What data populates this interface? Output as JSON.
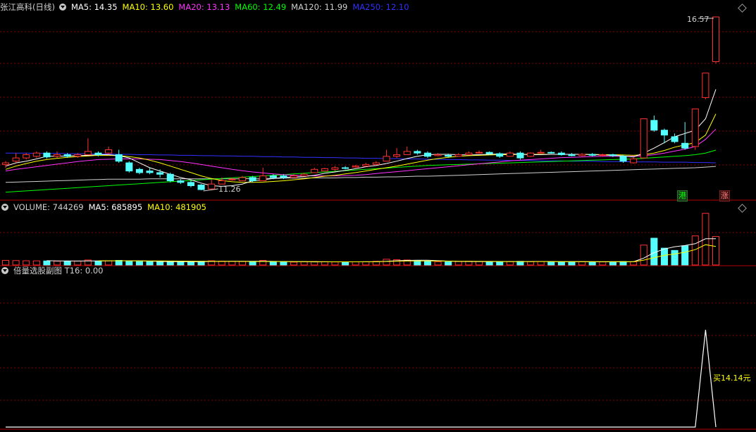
{
  "stock": {
    "name": "张江高科",
    "period": "(日线)"
  },
  "main_legend": [
    {
      "label": "MA5: 14.35",
      "color": "#ffffff"
    },
    {
      "label": "MA10: 13.60",
      "color": "#ffff00"
    },
    {
      "label": "MA20: 13.13",
      "color": "#ff33ff"
    },
    {
      "label": "MA60: 12.49",
      "color": "#00ff00"
    },
    {
      "label": "MA120: 11.99",
      "color": "#d0d0d0"
    },
    {
      "label": "MA250: 12.10",
      "color": "#3030ff"
    }
  ],
  "volume_legend": [
    {
      "label": "VOLUME: 744269",
      "color": "#d0d0d0"
    },
    {
      "label": "MA5: 685895",
      "color": "#ffffff"
    },
    {
      "label": "MA10: 481905",
      "color": "#ffff00"
    }
  ],
  "indicator_legend": {
    "label": "倍量选股副图  T16: 0.00",
    "color": "#d0d0d0"
  },
  "annotations": {
    "high": "16.57",
    "low": "11.26",
    "buy": "买14.14元"
  },
  "badges": {
    "hk": "港",
    "up": "涨"
  },
  "colors": {
    "up": "#ff3232",
    "down": "#54ffff",
    "grid": "#8a0000",
    "axis": "#b00000"
  },
  "chart_data": [
    {
      "type": "candlestick",
      "title": "张江高科 (日线)",
      "ohlc": [
        [
          12.05,
          12.1,
          11.95,
          12.15
        ],
        [
          12.15,
          12.25,
          12.1,
          12.4
        ],
        [
          12.25,
          12.35,
          12.2,
          12.4
        ],
        [
          12.3,
          12.4,
          12.25,
          12.45
        ],
        [
          12.4,
          12.28,
          12.23,
          12.45
        ],
        [
          12.3,
          12.35,
          12.25,
          12.45
        ],
        [
          12.35,
          12.3,
          12.25,
          12.4
        ],
        [
          12.3,
          12.35,
          12.25,
          12.4
        ],
        [
          12.35,
          12.45,
          12.35,
          12.85
        ],
        [
          12.4,
          12.35,
          12.3,
          12.45
        ],
        [
          12.4,
          12.5,
          12.35,
          12.6
        ],
        [
          12.35,
          12.15,
          12.1,
          12.5
        ],
        [
          12.1,
          11.85,
          11.8,
          12.15
        ],
        [
          11.9,
          11.8,
          11.75,
          11.95
        ],
        [
          11.85,
          11.8,
          11.75,
          11.95
        ],
        [
          11.8,
          11.75,
          11.65,
          11.9
        ],
        [
          11.75,
          11.55,
          11.5,
          11.8
        ],
        [
          11.55,
          11.5,
          11.45,
          11.6
        ],
        [
          11.5,
          11.4,
          11.35,
          11.55
        ],
        [
          11.42,
          11.28,
          11.26,
          11.45
        ],
        [
          11.3,
          11.45,
          11.28,
          11.6
        ],
        [
          11.45,
          11.55,
          11.45,
          11.65
        ],
        [
          11.6,
          11.6,
          11.55,
          11.65
        ],
        [
          11.55,
          11.65,
          11.55,
          11.7
        ],
        [
          11.65,
          11.55,
          11.5,
          11.7
        ],
        [
          11.55,
          11.7,
          11.55,
          11.95
        ],
        [
          11.7,
          11.65,
          11.6,
          11.75
        ],
        [
          11.7,
          11.65,
          11.6,
          11.75
        ],
        [
          11.65,
          11.7,
          11.65,
          11.75
        ],
        [
          11.7,
          11.75,
          11.7,
          11.8
        ],
        [
          11.8,
          11.9,
          11.8,
          11.95
        ],
        [
          11.85,
          11.92,
          11.85,
          11.95
        ],
        [
          11.9,
          11.95,
          11.85,
          12.0
        ],
        [
          11.95,
          11.93,
          11.9,
          12.0
        ],
        [
          11.97,
          12.0,
          11.95,
          12.03
        ],
        [
          12.0,
          12.05,
          11.98,
          12.1
        ],
        [
          12.05,
          12.1,
          12.05,
          12.15
        ],
        [
          12.15,
          12.3,
          12.15,
          12.5
        ],
        [
          12.3,
          12.35,
          12.25,
          12.55
        ],
        [
          12.35,
          12.45,
          12.35,
          12.6
        ],
        [
          12.45,
          12.4,
          12.35,
          12.5
        ],
        [
          12.4,
          12.3,
          12.25,
          12.45
        ],
        [
          12.32,
          12.35,
          12.3,
          12.4
        ],
        [
          12.33,
          12.3,
          12.25,
          12.38
        ],
        [
          12.3,
          12.35,
          12.3,
          12.4
        ],
        [
          12.35,
          12.4,
          12.35,
          12.45
        ],
        [
          12.4,
          12.42,
          12.38,
          12.48
        ],
        [
          12.42,
          12.38,
          12.35,
          12.45
        ],
        [
          12.38,
          12.3,
          12.25,
          12.42
        ],
        [
          12.3,
          12.4,
          12.3,
          12.45
        ],
        [
          12.4,
          12.25,
          12.2,
          12.45
        ],
        [
          12.3,
          12.4,
          12.28,
          12.42
        ],
        [
          12.4,
          12.42,
          12.4,
          12.5
        ],
        [
          12.42,
          12.4,
          12.38,
          12.45
        ],
        [
          12.4,
          12.35,
          12.32,
          12.45
        ],
        [
          12.35,
          12.32,
          12.3,
          12.4
        ],
        [
          12.32,
          12.36,
          12.3,
          12.4
        ],
        [
          12.36,
          12.33,
          12.3,
          12.4
        ],
        [
          12.33,
          12.35,
          12.3,
          12.38
        ],
        [
          12.35,
          12.32,
          12.28,
          12.38
        ],
        [
          12.3,
          12.15,
          12.1,
          12.35
        ],
        [
          12.1,
          12.22,
          12.08,
          12.26
        ],
        [
          12.25,
          13.45,
          12.25,
          13.45
        ],
        [
          13.4,
          13.1,
          13.05,
          13.55
        ],
        [
          13.1,
          12.95,
          12.7,
          13.15
        ],
        [
          12.9,
          12.75,
          12.7,
          13.0
        ],
        [
          12.7,
          12.55,
          12.5,
          13.35
        ],
        [
          12.6,
          13.75,
          12.5,
          13.75
        ],
        [
          14.1,
          14.85,
          14.05,
          14.85
        ],
        [
          15.2,
          16.57,
          15.15,
          16.57
        ]
      ],
      "ma": {
        "MA5": [
          12.0,
          12.1,
          12.15,
          12.22,
          12.3,
          12.3,
          12.31,
          12.32,
          12.33,
          12.35,
          12.35,
          12.32,
          12.25,
          12.1,
          11.95,
          11.85,
          11.75,
          11.65,
          11.58,
          11.48,
          11.4,
          11.38,
          11.4,
          11.45,
          11.55,
          11.58,
          11.62,
          11.65,
          11.67,
          11.68,
          11.72,
          11.78,
          11.82,
          11.87,
          11.92,
          11.98,
          12.02,
          12.08,
          12.15,
          12.23,
          12.3,
          12.35,
          12.36,
          12.36,
          12.35,
          12.34,
          12.35,
          12.36,
          12.37,
          12.37,
          12.36,
          12.35,
          12.35,
          12.36,
          12.36,
          12.36,
          12.36,
          12.35,
          12.34,
          12.33,
          12.31,
          12.28,
          12.4,
          12.55,
          12.72,
          12.9,
          13.0,
          13.1,
          13.45,
          14.35
        ],
        "MA10": [
          11.9,
          12.0,
          12.08,
          12.15,
          12.2,
          12.24,
          12.27,
          12.29,
          12.31,
          12.33,
          12.33,
          12.32,
          12.29,
          12.25,
          12.18,
          12.1,
          12.0,
          11.9,
          11.8,
          11.7,
          11.62,
          11.56,
          11.52,
          11.5,
          11.5,
          11.51,
          11.53,
          11.55,
          11.58,
          11.61,
          11.65,
          11.69,
          11.72,
          11.76,
          11.8,
          11.85,
          11.9,
          11.95,
          12.0,
          12.06,
          12.12,
          12.18,
          12.23,
          12.27,
          12.3,
          12.32,
          12.33,
          12.34,
          12.35,
          12.35,
          12.36,
          12.36,
          12.36,
          12.36,
          12.36,
          12.36,
          12.36,
          12.36,
          12.35,
          12.35,
          12.34,
          12.33,
          12.35,
          12.4,
          12.48,
          12.58,
          12.65,
          12.72,
          12.95,
          13.6
        ],
        "MA20": [
          11.85,
          11.9,
          11.94,
          11.98,
          12.02,
          12.06,
          12.1,
          12.14,
          12.17,
          12.2,
          12.21,
          12.22,
          12.22,
          12.22,
          12.21,
          12.2,
          12.17,
          12.14,
          12.1,
          12.05,
          12.0,
          11.95,
          11.9,
          11.86,
          11.82,
          11.79,
          11.76,
          11.74,
          11.72,
          11.71,
          11.7,
          11.7,
          11.7,
          11.71,
          11.72,
          11.74,
          11.77,
          11.8,
          11.83,
          11.86,
          11.89,
          11.92,
          11.95,
          11.98,
          12.01,
          12.04,
          12.07,
          12.1,
          12.13,
          12.16,
          12.18,
          12.2,
          12.22,
          12.24,
          12.26,
          12.27,
          12.28,
          12.29,
          12.3,
          12.3,
          12.3,
          12.3,
          12.32,
          12.35,
          12.4,
          12.46,
          12.52,
          12.6,
          12.82,
          13.13
        ],
        "MA60": [
          11.2,
          11.22,
          11.24,
          11.26,
          11.28,
          11.3,
          11.32,
          11.34,
          11.36,
          11.38,
          11.4,
          11.42,
          11.44,
          11.46,
          11.48,
          11.5,
          11.52,
          11.54,
          11.56,
          11.58,
          11.6,
          11.62,
          11.64,
          11.66,
          11.68,
          11.7,
          11.72,
          11.74,
          11.76,
          11.78,
          11.8,
          11.82,
          11.84,
          11.86,
          11.88,
          11.9,
          11.92,
          11.94,
          11.96,
          11.98,
          12.0,
          12.02,
          12.03,
          12.04,
          12.05,
          12.06,
          12.07,
          12.08,
          12.09,
          12.1,
          12.11,
          12.12,
          12.13,
          12.14,
          12.15,
          12.16,
          12.17,
          12.18,
          12.19,
          12.2,
          12.21,
          12.22,
          12.24,
          12.26,
          12.28,
          12.3,
          12.32,
          12.35,
          12.4,
          12.49
        ],
        "MA120": [
          11.5,
          11.51,
          11.52,
          11.53,
          11.54,
          11.55,
          11.56,
          11.57,
          11.58,
          11.59,
          11.6,
          11.6,
          11.6,
          11.6,
          11.61,
          11.61,
          11.61,
          11.61,
          11.61,
          11.61,
          11.61,
          11.61,
          11.61,
          11.61,
          11.62,
          11.62,
          11.62,
          11.63,
          11.63,
          11.63,
          11.64,
          11.64,
          11.64,
          11.65,
          11.65,
          11.66,
          11.66,
          11.67,
          11.67,
          11.68,
          11.69,
          11.69,
          11.7,
          11.71,
          11.72,
          11.73,
          11.74,
          11.75,
          11.76,
          11.77,
          11.78,
          11.79,
          11.8,
          11.81,
          11.82,
          11.83,
          11.84,
          11.85,
          11.86,
          11.87,
          11.88,
          11.89,
          11.9,
          11.91,
          11.92,
          11.93,
          11.94,
          11.95,
          11.97,
          11.99
        ],
        "MA250": [
          12.4,
          12.4,
          12.4,
          12.39,
          12.39,
          12.39,
          12.38,
          12.38,
          12.38,
          12.37,
          12.37,
          12.36,
          12.36,
          12.35,
          12.35,
          12.34,
          12.34,
          12.33,
          12.33,
          12.32,
          12.32,
          12.31,
          12.31,
          12.3,
          12.3,
          12.29,
          12.29,
          12.28,
          12.28,
          12.27,
          12.27,
          12.26,
          12.26,
          12.25,
          12.25,
          12.24,
          12.24,
          12.23,
          12.23,
          12.22,
          12.22,
          12.21,
          12.21,
          12.2,
          12.2,
          12.19,
          12.19,
          12.18,
          12.18,
          12.17,
          12.17,
          12.17,
          12.16,
          12.16,
          12.16,
          12.15,
          12.15,
          12.15,
          12.14,
          12.14,
          12.14,
          12.13,
          12.13,
          12.13,
          12.12,
          12.12,
          12.12,
          12.11,
          12.11,
          12.1
        ]
      }
    },
    {
      "type": "bar",
      "title": "VOLUME",
      "values": [
        120000,
        115000,
        110000,
        108000,
        105000,
        100000,
        98000,
        102000,
        130000,
        95000,
        110000,
        120000,
        95000,
        90000,
        88000,
        85000,
        90000,
        80000,
        85000,
        95000,
        110000,
        100000,
        95000,
        90000,
        85000,
        120000,
        80000,
        78000,
        75000,
        82000,
        90000,
        85000,
        80000,
        78000,
        82000,
        85000,
        95000,
        150000,
        140000,
        130000,
        110000,
        100000,
        85000,
        80000,
        90000,
        95000,
        92000,
        88000,
        85000,
        90000,
        95000,
        88000,
        90000,
        85000,
        82000,
        80000,
        85000,
        82000,
        80000,
        85000,
        90000,
        85000,
        520000,
        700000,
        440000,
        380000,
        500000,
        760000,
        1350000,
        744269
      ],
      "ma5": [
        null,
        null,
        null,
        null,
        111600,
        107600,
        104600,
        102600,
        107000,
        106000,
        107000,
        111400,
        110000,
        110000,
        100600,
        91600,
        88600,
        86600,
        85600,
        85000,
        92000,
        94000,
        97000,
        98000,
        97000,
        98000,
        94000,
        90600,
        87600,
        88000,
        81000,
        82000,
        82000,
        82000,
        83000,
        84000,
        84000,
        98000,
        110400,
        120000,
        125000,
        124000,
        113000,
        101000,
        93000,
        90000,
        88400,
        89000,
        90000,
        90000,
        90800,
        90400,
        91600,
        89600,
        88000,
        87000,
        86400,
        84600,
        82800,
        82400,
        84400,
        84400,
        181000,
        322000,
        418000,
        478000,
        508000,
        556000,
        686000,
        685895
      ],
      "ma10": [
        null,
        null,
        null,
        null,
        null,
        null,
        null,
        null,
        null,
        110300,
        109800,
        110300,
        108800,
        107000,
        105600,
        104100,
        103300,
        101100,
        99400,
        96600,
        96100,
        94600,
        94200,
        93100,
        90600,
        90000,
        89500,
        90000,
        89000,
        88700,
        86700,
        85200,
        83700,
        82700,
        82400,
        83800,
        85300,
        92200,
        98900,
        103700,
        106500,
        104900,
        103600,
        101000,
        97700,
        95400,
        94700,
        93900,
        91400,
        89300,
        89800,
        89300,
        89800,
        89800,
        88300,
        87400,
        86900,
        86900,
        86400,
        85700,
        85900,
        85000,
        128000,
        190800,
        253000,
        286600,
        333000,
        401400,
        530600,
        481905
      ]
    },
    {
      "type": "line",
      "title": "倍量选股副图",
      "values": [
        0,
        0,
        0,
        0,
        0,
        0,
        0,
        0,
        0,
        0,
        0,
        0,
        0,
        0,
        0,
        0,
        0,
        0,
        0,
        0,
        0,
        0,
        0,
        0,
        0,
        0,
        0,
        0,
        0,
        0,
        0,
        0,
        0,
        0,
        0,
        0,
        0,
        0,
        0,
        0,
        0,
        0,
        0,
        0,
        0,
        0,
        0,
        0,
        0,
        0,
        0,
        0,
        0,
        0,
        0,
        0,
        0,
        0,
        0,
        0,
        0,
        0,
        0,
        0,
        0,
        0,
        0,
        0,
        1,
        0
      ],
      "annotation": "买14.14元"
    }
  ]
}
